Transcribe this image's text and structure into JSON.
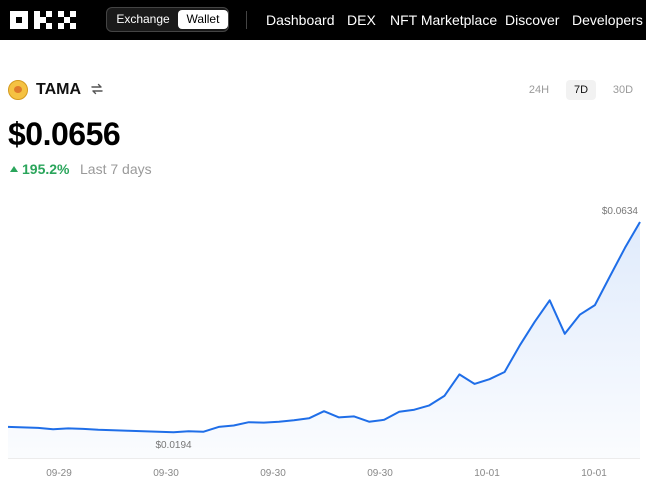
{
  "nav": {
    "toggle": {
      "exchange": "Exchange",
      "wallet": "Wallet"
    },
    "items": [
      "Dashboard",
      "DEX",
      "NFT Marketplace",
      "Discover",
      "Developers"
    ]
  },
  "token": {
    "symbol": "TAMA",
    "price": "$0.0656",
    "change": "195.2%",
    "change_label": "Last 7 days",
    "ranges": [
      "24H",
      "7D",
      "30D"
    ],
    "active_range": "7D"
  },
  "colors": {
    "accent": "#1f6ee8",
    "positive": "#2aa55b",
    "topbar": "#000000"
  },
  "chart_data": {
    "type": "area",
    "series": [
      {
        "values": [
          0.0205,
          0.0204,
          0.0203,
          0.02,
          0.0202,
          0.0201,
          0.0199,
          0.0198,
          0.0197,
          0.0196,
          0.0195,
          0.0194,
          0.0196,
          0.0195,
          0.0205,
          0.0208,
          0.0215,
          0.0214,
          0.0216,
          0.0219,
          0.0223,
          0.0238,
          0.0225,
          0.0227,
          0.0216,
          0.022,
          0.0237,
          0.0241,
          0.025,
          0.027,
          0.0315,
          0.0295,
          0.0305,
          0.032,
          0.0375,
          0.0425,
          0.047,
          0.04,
          0.044,
          0.046,
          0.052,
          0.058,
          0.0634
        ]
      }
    ],
    "x_tick_labels": [
      "09-29",
      "09-30",
      "09-30",
      "09-30",
      "10-01",
      "10-01"
    ],
    "annotations": {
      "max_label": "$0.0634",
      "min_label": "$0.0194"
    },
    "ylim": [
      0.014,
      0.068
    ],
    "grid": false
  }
}
